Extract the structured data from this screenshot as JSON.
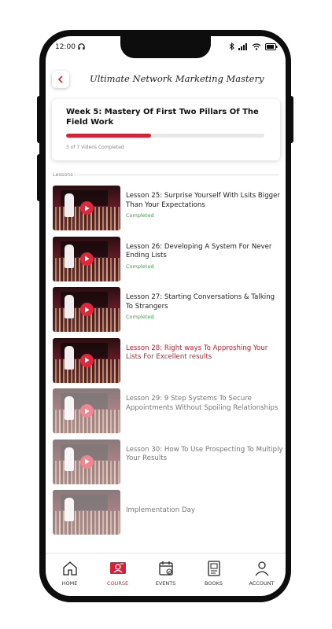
{
  "status_bar": {
    "time": "12:00"
  },
  "header": {
    "title": "Ultimate Network Marketing Mastery"
  },
  "week": {
    "title": "Week 5: Mastery Of First Two Pillars Of The Field Work",
    "progress": 0.43,
    "progress_text": "3 of 7 Videos Completed"
  },
  "lessons_label": "Lessons",
  "lessons": [
    {
      "title": "Lesson 25: Surprise Yourself With Lsits Bigger Than Your Expectations",
      "status": "Completed"
    },
    {
      "title": "Lesson 26: Developing A System For Never Ending Lists",
      "status": "Completed"
    },
    {
      "title": "Lesson 27: Starting Conversations & Talking To Strangers",
      "status": "Completed"
    },
    {
      "title": "Lesson 28: Right ways To Approshing Your Lists For Excellent results",
      "status": ""
    },
    {
      "title": "Lesson 29: 9 Step Systems To Secure Appointments Without Spoiling Relationships",
      "status": ""
    },
    {
      "title": "Lesson 30: How To Use Prospecting To Multiply Your Results",
      "status": ""
    },
    {
      "title": "Implementation Day",
      "status": ""
    }
  ],
  "nav": {
    "home": "HOME",
    "course": "COURSE",
    "events": "EVENTS",
    "books": "BOOKS",
    "account": "ACCOUNT",
    "active": "course"
  },
  "colors": {
    "accent": "#d2233a",
    "completed": "#3aa34a"
  }
}
